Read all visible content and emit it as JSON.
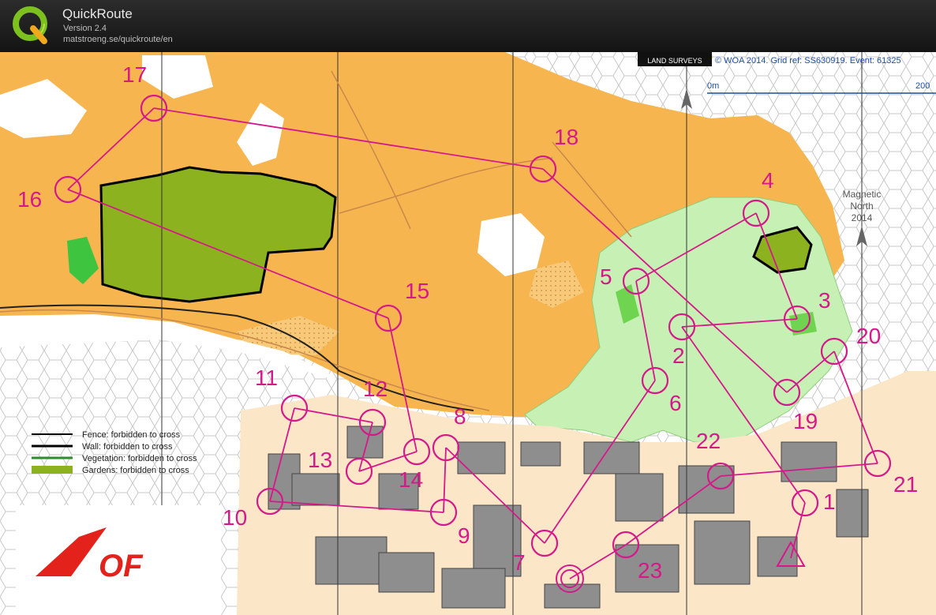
{
  "app": {
    "title": "QuickRoute",
    "version": "Version 2.4",
    "url": "matstroeng.se/quickroute/en"
  },
  "map": {
    "credit": "© WOA 2014. Grid ref: SS630919. Event: 61325",
    "credit_logo_text": "LAND SURVEYS",
    "scale_start": "0m",
    "scale_end": "200",
    "north_label": [
      "Magnetic",
      "North",
      "2014"
    ],
    "legend": [
      {
        "label": "Fence: forbidden to cross",
        "color": "#000000"
      },
      {
        "label": "Wall: forbidden to cross",
        "color": "#000000"
      },
      {
        "label": "Vegetation: forbidden to cross",
        "color": "#2e8b2e"
      },
      {
        "label": "Gardens: forbidden to cross",
        "color": "#8db21f"
      }
    ],
    "club_logo_text": "OF",
    "course_color": "#d6198a",
    "controls": [
      "1",
      "2",
      "3",
      "4",
      "5",
      "6",
      "7",
      "8",
      "9",
      "10",
      "11",
      "12",
      "13",
      "14",
      "15",
      "16",
      "17",
      "18",
      "19",
      "20",
      "21",
      "22",
      "23"
    ]
  }
}
